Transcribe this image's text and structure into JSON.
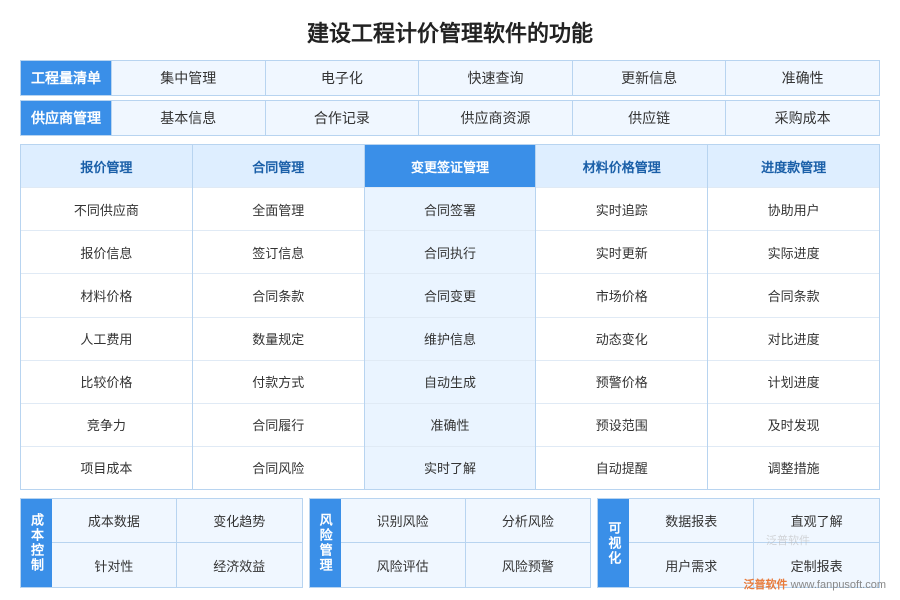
{
  "title": "建设工程计价管理软件的功能",
  "row1": {
    "label": "工程量清单",
    "cells": [
      "集中管理",
      "电子化",
      "快速查询",
      "更新信息",
      "准确性"
    ]
  },
  "row2": {
    "label": "供应商管理",
    "cells": [
      "基本信息",
      "合作记录",
      "供应商资源",
      "供应链",
      "采购成本"
    ]
  },
  "cols": [
    {
      "header": "报价管理",
      "items": [
        "不同供应商",
        "报价信息",
        "材料价格",
        "人工费用",
        "比较价格",
        "竞争力",
        "项目成本"
      ]
    },
    {
      "header": "合同管理",
      "items": [
        "全面管理",
        "签订信息",
        "合同条款",
        "数量规定",
        "付款方式",
        "合同履行",
        "合同风险"
      ]
    },
    {
      "header": "变更签证管理",
      "items": [
        "合同签署",
        "合同执行",
        "合同变更",
        "维护信息",
        "自动生成",
        "准确性",
        "实时了解"
      ],
      "highlight": true
    },
    {
      "header": "材料价格管理",
      "items": [
        "实时追踪",
        "实时更新",
        "市场价格",
        "动态变化",
        "预警价格",
        "预设范围",
        "自动提醒"
      ]
    },
    {
      "header": "进度款管理",
      "items": [
        "协助用户",
        "实际进度",
        "合同条款",
        "对比进度",
        "计划进度",
        "及时发现",
        "调整措施"
      ]
    }
  ],
  "bottom": [
    {
      "label": "成本控制",
      "cells": [
        "成本数据",
        "变化趋势",
        "针对性",
        "经济效益"
      ]
    },
    {
      "label": "风险管理",
      "cells": [
        "识别风险",
        "分析风险",
        "风险评估",
        "风险预警"
      ]
    },
    {
      "label": "可视化",
      "cells": [
        "数据报表",
        "直观了解",
        "用户需求",
        "定制报表"
      ]
    }
  ],
  "watermark": "泛普软件",
  "logo": "www.fanpusoft.com"
}
